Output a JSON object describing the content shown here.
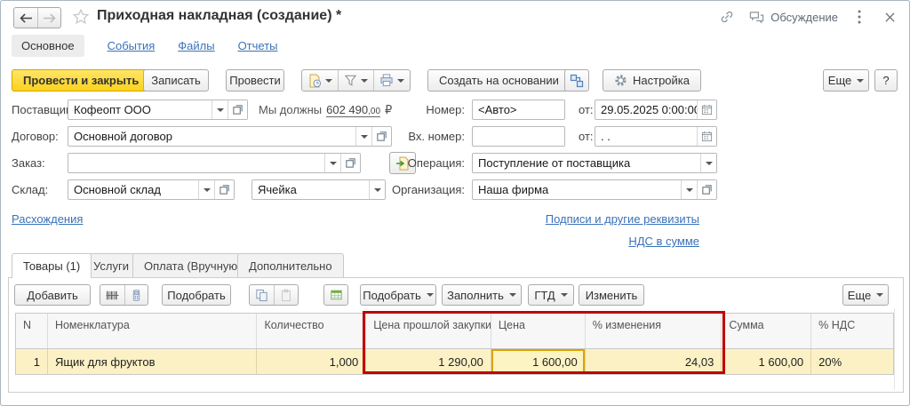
{
  "colors": {
    "primary_button_yellow": "#FCD21D",
    "annotation_red": "#C00000",
    "row_highlight_yellow": "#FBF1C5",
    "selected_cell_border": "#DCA400",
    "link_blue": "#3A72B8"
  },
  "icons": {
    "back": "arrow-left",
    "forward": "arrow-right",
    "favorite": "star-outline",
    "get_link": "chain-link",
    "discussion": "speech-bubbles",
    "more": "vertical-dots",
    "close": "cross",
    "posting": "document-with-clock",
    "filter": "funnel",
    "print": "printer",
    "related_documents": "linked-squares",
    "settings": "gear",
    "fill_from_order": "document-green-arrow",
    "barcode_scan": "barcode",
    "data_terminal": "handheld-terminal",
    "copy": "two-documents",
    "paste": "clipboard",
    "price_list": "green-table",
    "calendar": "calendar",
    "open_field": "overlapping-squares",
    "dropdown": "down-triangle"
  },
  "window": {
    "title": "Приходная накладная (создание) *",
    "discussion_label": "Обсуждение"
  },
  "nav": {
    "tabs": [
      {
        "label": "Основное"
      },
      {
        "label": "События"
      },
      {
        "label": "Файлы"
      },
      {
        "label": "Отчеты"
      }
    ]
  },
  "toolbar": {
    "post_and_close": "Провести и закрыть",
    "write": "Записать",
    "post": "Провести",
    "create_based_on": "Создать на основании",
    "settings": "Настройка",
    "more": "Еще",
    "help": "?"
  },
  "form": {
    "supplier_label": "Поставщик:",
    "supplier_value": "Кофеопт ООО",
    "debt_text": "Мы должны",
    "debt_amount": "602 490",
    "debt_decimals": ",00",
    "debt_currency": "₽",
    "number_label": "Номер:",
    "number_placeholder": "<Авто>",
    "from_label": "от:",
    "date_value": "29.05.2025 0:00:00",
    "contract_label": "Договор:",
    "contract_value": "Основной договор",
    "incoming_number_label": "Вх. номер:",
    "incoming_date_placeholder": ". .",
    "order_label": "Заказ:",
    "operation_label": "Операция:",
    "operation_value": "Поступление от поставщика",
    "warehouse_label": "Склад:",
    "warehouse_value": "Основной склад",
    "cell_placeholder": "Ячейка",
    "organization_label": "Организация:",
    "organization_value": "Наша фирма",
    "links": {
      "discrepancies": "Расхождения",
      "signatures": "Подписи и другие реквизиты",
      "vat": "НДС в сумме"
    }
  },
  "doc_tabs": [
    {
      "label": "Товары (1)",
      "active": true
    },
    {
      "label": "Услуги"
    },
    {
      "label": "Оплата (Вручную)"
    },
    {
      "label": "Дополнительно"
    }
  ],
  "table_toolbar": {
    "add": "Добавить",
    "pick": "Подобрать",
    "pick_menu": "Подобрать",
    "fill": "Заполнить",
    "gtd": "ГТД",
    "edit": "Изменить",
    "more": "Еще"
  },
  "table": {
    "columns": [
      "N",
      "Номенклатура",
      "Количество",
      "Цена прошлой закупки",
      "Цена",
      "% изменения",
      "Сумма",
      "% НДС"
    ],
    "rows": [
      {
        "n": "1",
        "item": "Ящик для фруктов",
        "qty": "1,000",
        "prev_price": "1 290,00",
        "price": "1 600,00",
        "change_pct": "24,03",
        "sum": "1 600,00",
        "vat": "20%"
      }
    ]
  }
}
